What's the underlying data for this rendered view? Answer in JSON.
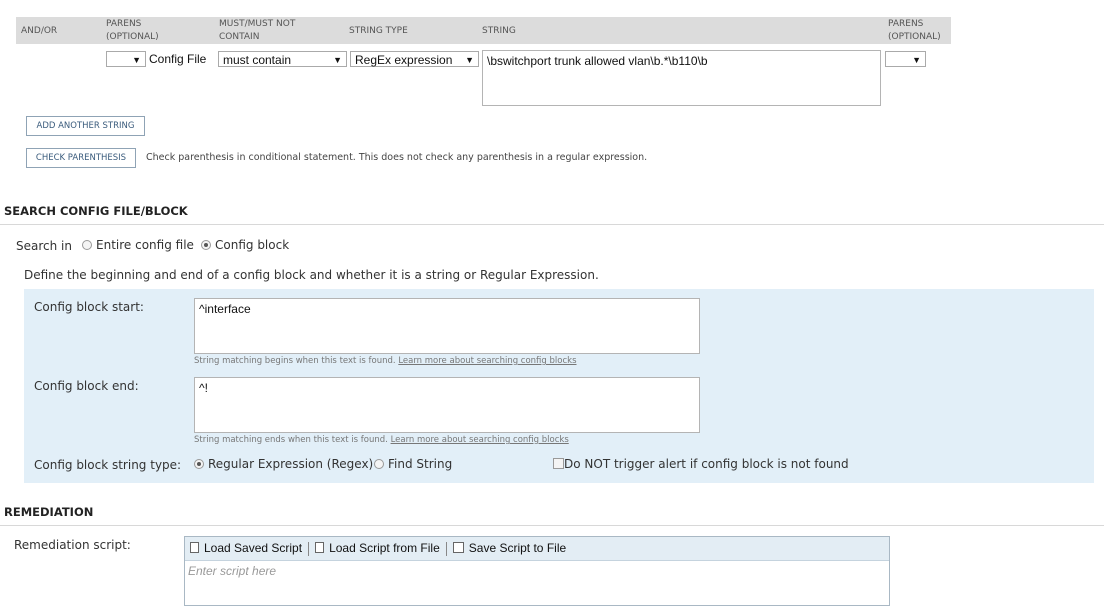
{
  "header": {
    "and_or": "AND/OR",
    "parens_open": "PARENS (OPTIONAL)",
    "must": "MUST/MUST NOT CONTAIN",
    "string_type": "STRING TYPE",
    "string": "STRING",
    "parens_close": "PARENS (OPTIONAL)"
  },
  "row": {
    "open_paren": "",
    "target": "Config File",
    "must_value": "must contain",
    "type_value": "RegEx expression",
    "string_value": "\\bswitchport trunk allowed vlan\\b.*\\b110\\b",
    "close_paren": "",
    "arrow": "▼"
  },
  "buttons": {
    "add_string": "ADD ANOTHER STRING",
    "check_parens": "CHECK PARENTHESIS",
    "check_note": "Check parenthesis in conditional statement. This does not check any parenthesis in a regular expression."
  },
  "search": {
    "title": "SEARCH CONFIG FILE/BLOCK",
    "search_in": "Search in",
    "entire": "Entire config file",
    "block": "Config block",
    "selected": "block",
    "define": "Define the beginning and end of a config block and whether it is a string or Regular Expression.",
    "start_label": "Config block start:",
    "start_value": "^interface",
    "start_help": "String matching begins when this text is found.",
    "end_label": "Config block end:",
    "end_value": "^!",
    "end_help": "String matching ends when this text is found.",
    "learn_more": "Learn more about searching config blocks",
    "type_label": "Config block string type:",
    "regex": "Regular Expression (Regex)",
    "find": "Find String",
    "type_selected": "regex",
    "no_trigger": "Do NOT trigger alert if config block is not found",
    "no_trigger_checked": false
  },
  "remediation": {
    "title": "REMEDIATION",
    "label": "Remediation script:",
    "load_saved": "Load Saved Script",
    "load_file": "Load Script from File",
    "save_file": "Save Script to File",
    "placeholder": "Enter script here"
  }
}
